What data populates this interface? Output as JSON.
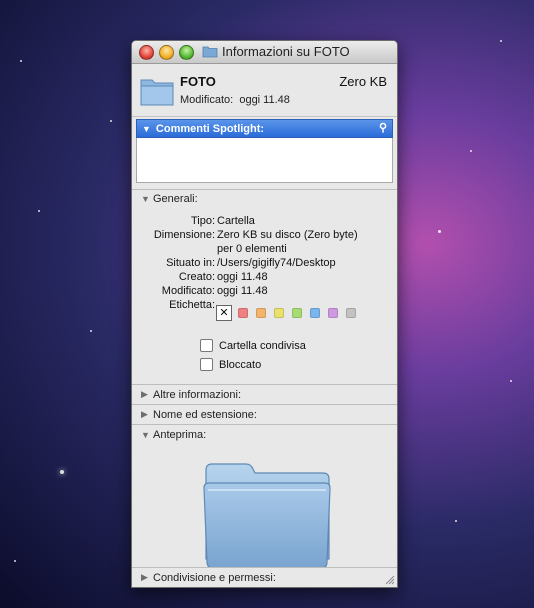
{
  "window": {
    "title": "Informazioni su FOTO"
  },
  "header": {
    "name": "FOTO",
    "size": "Zero KB",
    "modified_label": "Modificato:",
    "modified_value": "oggi 11.48"
  },
  "spotlight": {
    "label": "Commenti Spotlight:"
  },
  "general": {
    "label": "Generali:",
    "rows": [
      {
        "label": "Tipo:",
        "value": "Cartella"
      },
      {
        "label": "Dimensione:",
        "value": "Zero KB su disco (Zero byte)"
      },
      {
        "label": "",
        "value": "per 0 elementi"
      },
      {
        "label": "Situato in:",
        "value": "/Users/gigifly74/Desktop"
      },
      {
        "label": "Creato:",
        "value": "oggi 11.48"
      },
      {
        "label": "Modificato:",
        "value": "oggi 11.48"
      }
    ],
    "label_field": "Etichetta:",
    "label_none": "✕",
    "label_colors": [
      "#f07f7f",
      "#f5b46b",
      "#eae16a",
      "#a8dc73",
      "#79b5ee",
      "#cf99e2",
      "#c2c2c2"
    ],
    "shared_folder": "Cartella condivisa",
    "locked": "Bloccato"
  },
  "sections": {
    "more_info": "Altre informazioni:",
    "name_ext": "Nome ed estensione:",
    "preview": "Anteprima:",
    "sharing": "Condivisione e permessi:"
  }
}
